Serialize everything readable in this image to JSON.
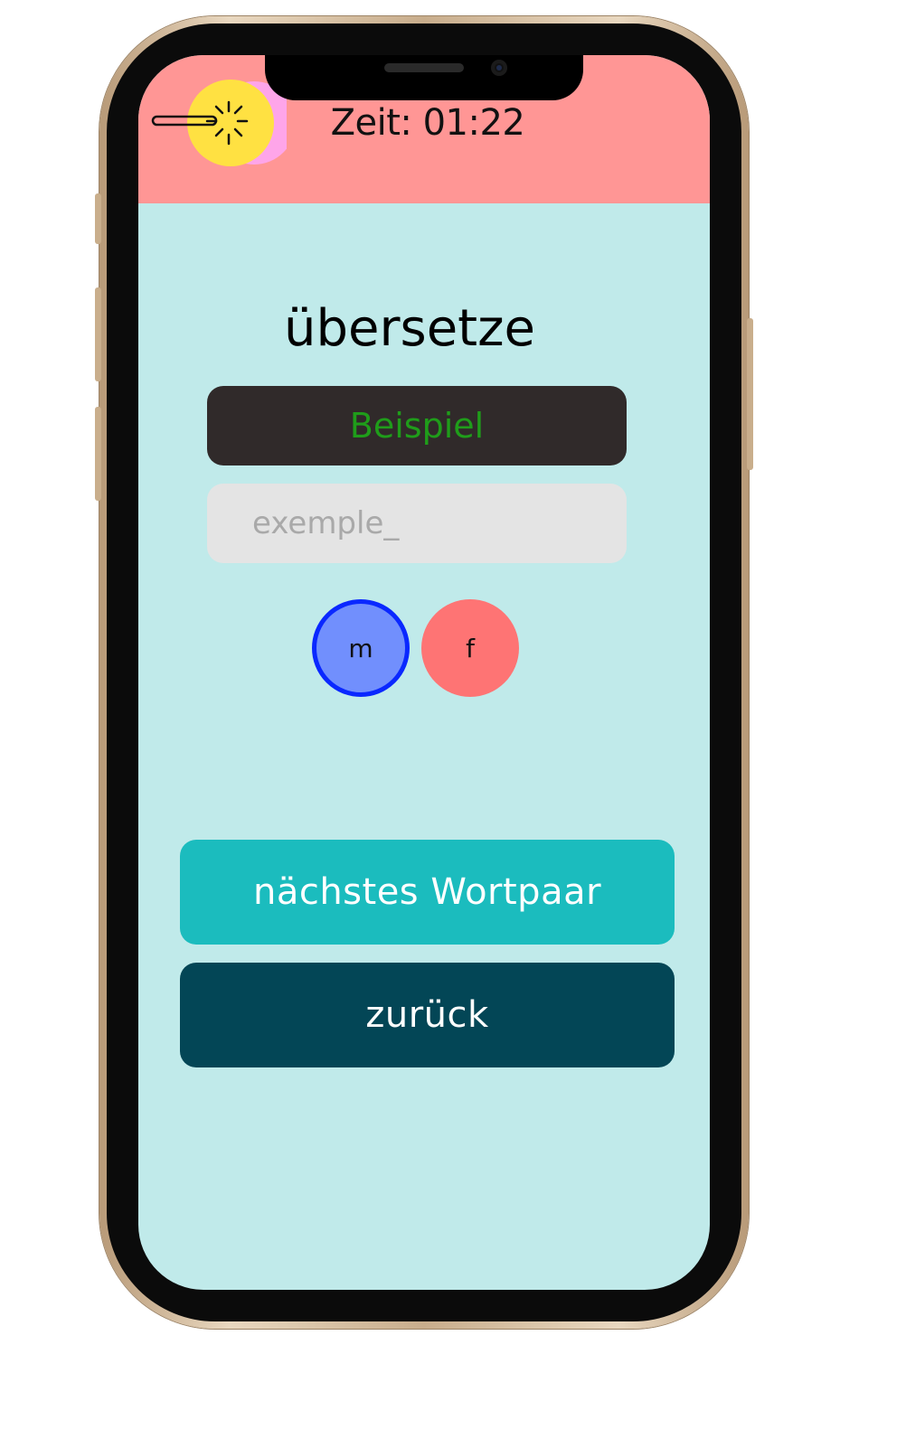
{
  "header": {
    "timer_text": "Zeit: 01:22",
    "background": "#ff9695"
  },
  "menu": {
    "icon": "magic-wand-icon"
  },
  "exercise": {
    "title": "übersetze",
    "source_word": "Beispiel",
    "answer_placeholder": "exemple_"
  },
  "gender": {
    "masculine_label": "m",
    "feminine_label": "f",
    "selected": "m"
  },
  "actions": {
    "next_label": "nächstes Wortpaar",
    "back_label": "zurück"
  },
  "colors": {
    "screen_bg": "#c0eaea",
    "word_card": "#302a2a",
    "word_text": "#1f9d1a",
    "next_button": "#1bbcbe",
    "back_button": "#034656",
    "masculine": "#718ffd",
    "feminine": "#fe7474"
  }
}
